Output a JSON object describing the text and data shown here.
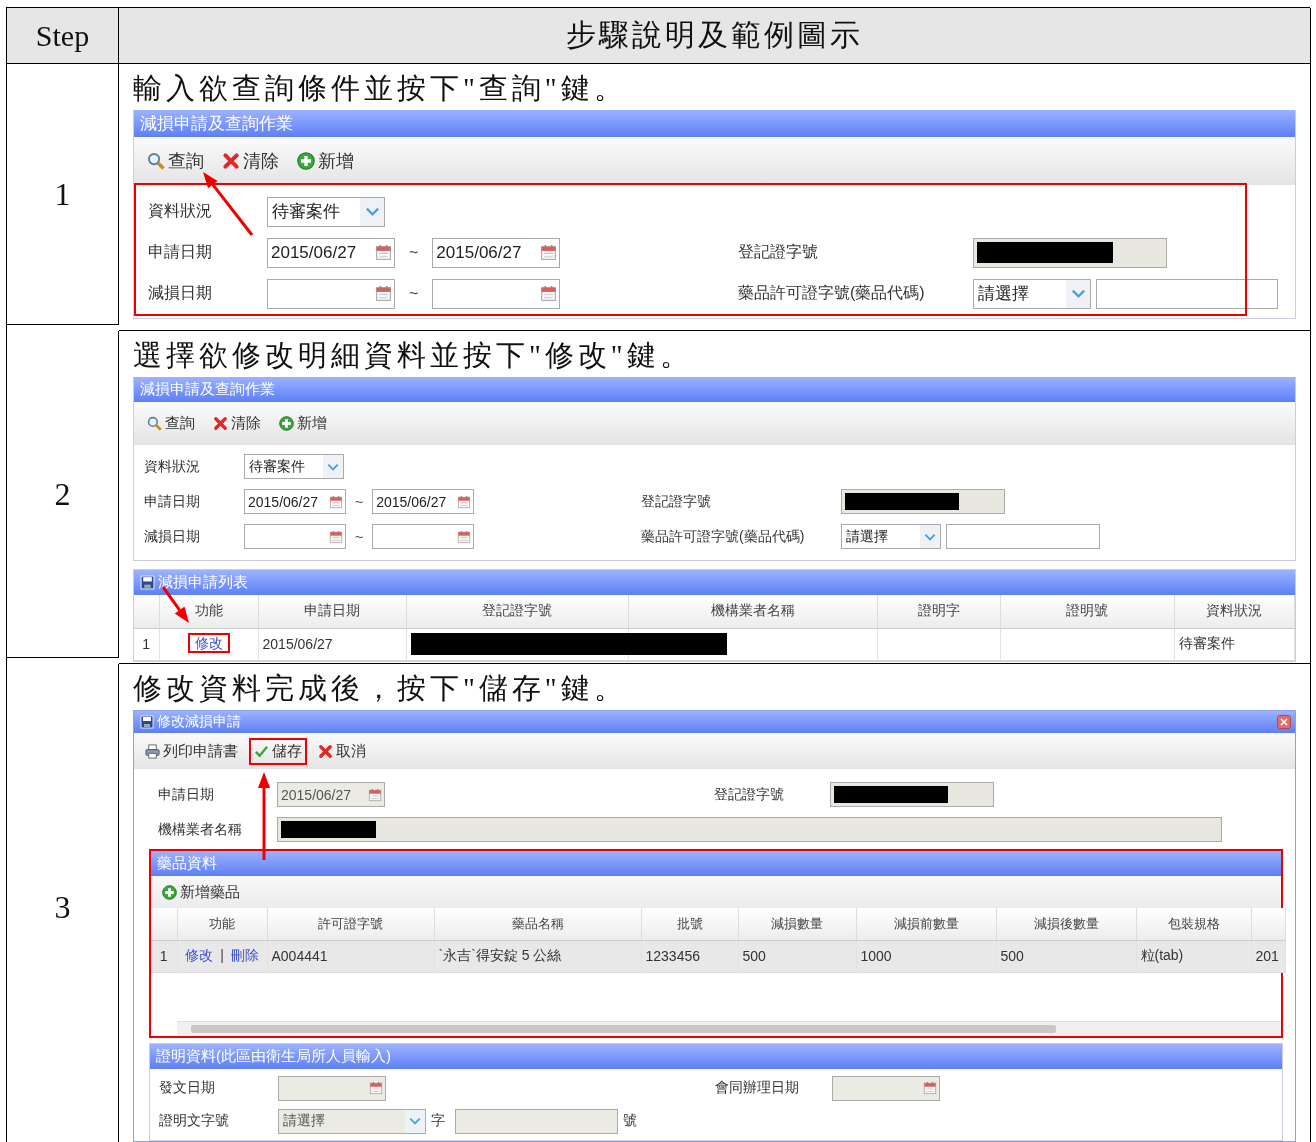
{
  "header": {
    "step": "Step",
    "description": "步驟說明及範例圖示"
  },
  "steps": [
    {
      "number": "1",
      "instruction": "輸入欲查詢條件並按下\"查詢\"鍵。",
      "screen": {
        "kind": "query",
        "title": "減損申請及查詢作業",
        "toolbar": [
          {
            "kind": "search",
            "label": "查詢"
          },
          {
            "kind": "clear",
            "label": "清除"
          },
          {
            "kind": "add",
            "label": "新增"
          }
        ],
        "form": {
          "highlighted": true,
          "rows": [
            {
              "left": {
                "label": "資料狀況",
                "kind": "select",
                "value": "待審案件"
              }
            },
            {
              "left": {
                "label": "申請日期",
                "kind": "date-range",
                "from": "2015/06/27",
                "separator": "~",
                "to": "2015/06/27"
              },
              "right": {
                "label": "登記證字號",
                "kind": "redacted"
              }
            },
            {
              "left": {
                "label": "減損日期",
                "kind": "date-range",
                "separator": "~"
              },
              "right": {
                "label": "藥品許可證字號(藥品代碼)",
                "kind": "select-text",
                "value": "請選擇"
              }
            }
          ]
        }
      }
    },
    {
      "number": "2",
      "instruction": "選擇欲修改明細資料並按下\"修改\"鍵。",
      "screen": {
        "kind": "query",
        "title": "減損申請及查詢作業",
        "toolbar": [
          {
            "kind": "search",
            "label": "查詢"
          },
          {
            "kind": "clear",
            "label": "清除"
          },
          {
            "kind": "add",
            "label": "新增"
          }
        ],
        "form": {
          "rows": [
            {
              "left": {
                "label": "資料狀況",
                "kind": "select",
                "value": "待審案件"
              }
            },
            {
              "left": {
                "label": "申請日期",
                "kind": "date-range",
                "from": "2015/06/27",
                "separator": "~",
                "to": "2015/06/27"
              },
              "right": {
                "label": "登記證字號",
                "kind": "redacted"
              }
            },
            {
              "left": {
                "label": "減損日期",
                "kind": "date-range",
                "separator": "~"
              },
              "right": {
                "label": "藥品許可證字號(藥品代碼)",
                "kind": "select-text",
                "value": "請選擇"
              }
            }
          ]
        },
        "list": {
          "title": "減損申請列表",
          "columns": [
            "功能",
            "申請日期",
            "登記證字號",
            "機構業者名稱",
            "證明字",
            "證明號",
            "資料狀況"
          ],
          "rows": [
            {
              "index": "1",
              "selected": false,
              "cells": [
                {
                  "kind": "link",
                  "text": "修改",
                  "highlighted": true
                },
                {
                  "kind": "text",
                  "text": "2015/06/27"
                },
                {
                  "kind": "redacted"
                },
                {
                  "kind": "blank"
                },
                {
                  "kind": "blank"
                },
                {
                  "kind": "blank"
                },
                {
                  "kind": "text",
                  "text": "待審案件"
                }
              ]
            }
          ]
        }
      }
    },
    {
      "number": "3",
      "instruction": "修改資料完成後，按下\"儲存\"鍵。",
      "screen": {
        "kind": "edit-dialog",
        "title": "修改減損申請",
        "toolbar": [
          {
            "kind": "print",
            "label": "列印申請書",
            "highlighted": false
          },
          {
            "kind": "save",
            "label": "儲存",
            "highlighted": true
          },
          {
            "kind": "cancel",
            "label": "取消",
            "highlighted": false
          }
        ],
        "form": {
          "rows": [
            {
              "left": {
                "label": "申請日期",
                "kind": "date",
                "value": "2015/06/27",
                "disabled": true
              },
              "right": {
                "label": "登記證字號",
                "kind": "redacted"
              }
            },
            {
              "left": {
                "label": "機構業者名稱",
                "kind": "redacted-wide"
              }
            }
          ]
        },
        "drugs": {
          "title": "藥品資料",
          "highlighted": true,
          "toolbar": [
            {
              "kind": "add",
              "label": "新增藥品"
            }
          ],
          "columns": [
            "功能",
            "許可證字號",
            "藥品名稱",
            "批號",
            "減損數量",
            "減損前數量",
            "減損後數量",
            "包裝規格"
          ],
          "rows": [
            {
              "index": "1",
              "selected": true,
              "cells": [
                {
                  "kind": "links",
                  "links": [
                    "修改",
                    "刪除"
                  ],
                  "separator": "|"
                },
                {
                  "kind": "text",
                  "text": "A004441"
                },
                {
                  "kind": "text",
                  "text": "`永吉`得安錠 5 公絲"
                },
                {
                  "kind": "text",
                  "text": "1233456"
                },
                {
                  "kind": "text",
                  "text": "500"
                },
                {
                  "kind": "text",
                  "text": "1000"
                },
                {
                  "kind": "text",
                  "text": "500"
                },
                {
                  "kind": "text",
                  "text": "粒(tab)"
                },
                {
                  "kind": "text",
                  "text": "201"
                }
              ]
            }
          ]
        },
        "certificate": {
          "title": "證明資料(此區由衛生局所人員輸入)",
          "rows": [
            {
              "left": {
                "label": "發文日期",
                "kind": "date",
                "disabled": true
              },
              "right": {
                "label": "會同辦理日期",
                "kind": "date",
                "disabled": true
              }
            },
            {
              "left": {
                "label": "證明文字號",
                "kind": "doc-number",
                "value": "請選擇",
                "middle": "字",
                "suffix": "號",
                "disabled": true
              }
            }
          ]
        }
      }
    }
  ]
}
